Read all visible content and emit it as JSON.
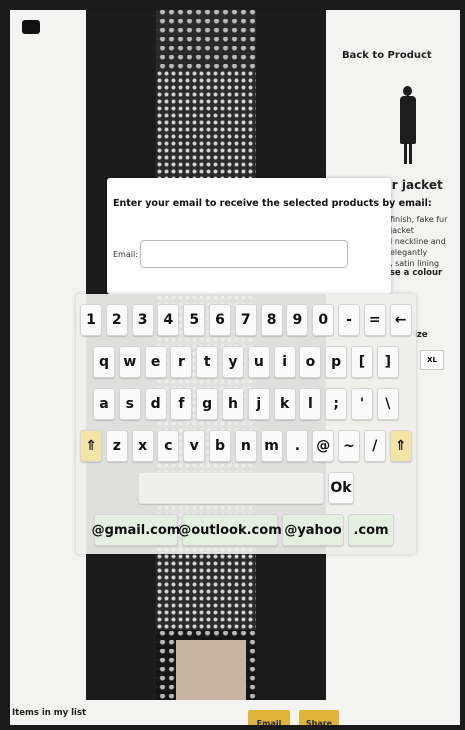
{
  "product_page": {
    "back_link": "Back to Product",
    "product_title": "fur jacket",
    "description_lines": [
      "finish, fake fur jacket",
      "l neckline and elegantly",
      ", satin lining"
    ],
    "colour_label": "ose a colour",
    "size_label": "ize",
    "size_option": "XL",
    "items_label": "Items in my list",
    "email_button": "Email",
    "share_button": "Share"
  },
  "modal": {
    "title": "Enter your email to receive the selected products by email:",
    "email_label": "Email:",
    "email_value": "",
    "email_placeholder": ""
  },
  "keyboard": {
    "row1": [
      "1",
      "2",
      "3",
      "4",
      "5",
      "6",
      "7",
      "8",
      "9",
      "0",
      "-",
      "=",
      "←"
    ],
    "row2": [
      "q",
      "w",
      "e",
      "r",
      "t",
      "y",
      "u",
      "i",
      "o",
      "p",
      "[",
      "]"
    ],
    "row3": [
      "a",
      "s",
      "d",
      "f",
      "g",
      "h",
      "j",
      "k",
      "l",
      ";",
      "'",
      "\\"
    ],
    "row4": [
      "⇑",
      "z",
      "x",
      "c",
      "v",
      "b",
      "n",
      "m",
      ".",
      "@",
      "~",
      "/",
      "⇑"
    ],
    "ok": "Ok",
    "domains": [
      "@gmail.com",
      "@outlook.com",
      "@yahoo",
      ".com"
    ]
  },
  "colors": {
    "accent_gold": "#e0b43a",
    "shift_key": "#f4e5a6",
    "domain_key": "#e3f0df"
  }
}
